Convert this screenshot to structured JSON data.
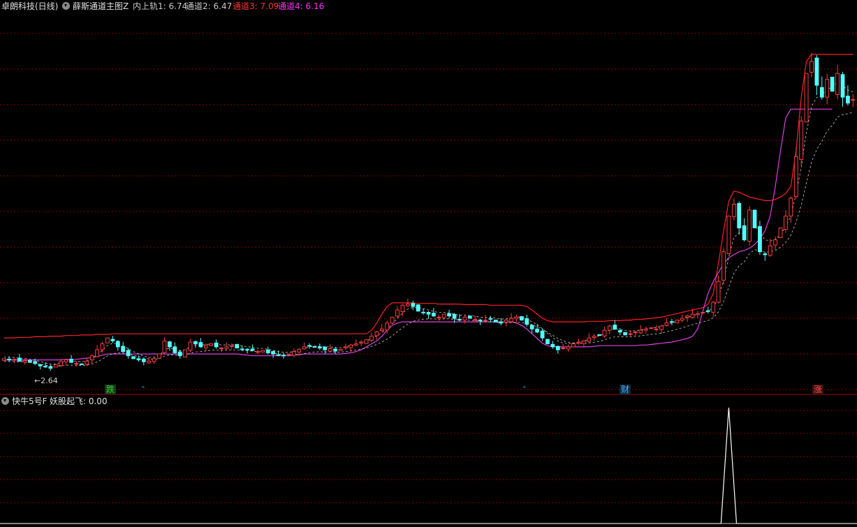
{
  "header": {
    "stock_name": "卓朗科技",
    "period": "(日线)",
    "indicator_name": "薛斯通道主图Z",
    "inner_upper_label": "内上轨1: 6.74",
    "channel2_label": "通道2: 6.47",
    "channel3_label": "通道3: 7.09",
    "channel4_label": "通道4: 6.16",
    "colors": {
      "white": "#c8c8c8",
      "channel3": "#ff3232",
      "channel4": "#ff32ff"
    }
  },
  "lower_panel": {
    "indicator_name": "快牛5号F",
    "value_label": "妖股起飞: 0.00"
  },
  "markers": [
    {
      "text": "跌",
      "color": "#30d030",
      "bg": "#1a3a1a"
    },
    {
      "text": "财",
      "color": "#40b0ff",
      "bg": "#102a40"
    },
    {
      "text": "涨",
      "color": "#ff5050",
      "bg": "#401010"
    }
  ],
  "low_price_label": "2.64",
  "chart_data": {
    "type": "candlestick",
    "price_range": [
      2.4,
      8.6
    ],
    "colors": {
      "up": "#ff3c3c",
      "down": "#54ffff",
      "upper_channel": "#ff2020",
      "lower_channel": "#e040e0",
      "dashed": "#c8c8c8",
      "grid": "#8b0000"
    },
    "closes": [
      2.8,
      2.78,
      2.79,
      2.76,
      2.77,
      2.74,
      2.72,
      2.68,
      2.66,
      2.64,
      2.7,
      2.75,
      2.78,
      2.74,
      2.72,
      2.7,
      2.76,
      2.85,
      2.95,
      3.05,
      3.15,
      3.1,
      3.0,
      2.92,
      2.85,
      2.8,
      2.78,
      2.75,
      2.76,
      2.8,
      2.88,
      3.1,
      3.0,
      2.9,
      2.85,
      2.95,
      3.08,
      3.05,
      3.0,
      3.02,
      3.05,
      3.0,
      2.98,
      3.0,
      3.02,
      2.98,
      2.96,
      2.95,
      2.94,
      2.92,
      2.94,
      2.9,
      2.88,
      2.86,
      2.85,
      2.88,
      2.92,
      2.96,
      3.0,
      3.02,
      3.0,
      2.98,
      2.95,
      2.97,
      2.93,
      2.96,
      3.0,
      3.03,
      3.05,
      3.08,
      3.12,
      3.18,
      3.25,
      3.3,
      3.4,
      3.5,
      3.62,
      3.7,
      3.72,
      3.68,
      3.6,
      3.58,
      3.55,
      3.52,
      3.5,
      3.55,
      3.52,
      3.48,
      3.45,
      3.5,
      3.48,
      3.46,
      3.44,
      3.45,
      3.47,
      3.42,
      3.4,
      3.45,
      3.48,
      3.5,
      3.45,
      3.38,
      3.3,
      3.25,
      3.15,
      3.05,
      3.0,
      2.95,
      2.98,
      3.0,
      3.05,
      3.08,
      3.1,
      3.15,
      3.18,
      3.2,
      3.28,
      3.35,
      3.3,
      3.25,
      3.2,
      3.22,
      3.25,
      3.28,
      3.3,
      3.32,
      3.3,
      3.35,
      3.4,
      3.42,
      3.45,
      3.48,
      3.52,
      3.55,
      3.56,
      3.58,
      3.6,
      3.75,
      4.1,
      4.6,
      5.2,
      5.4,
      5.0,
      4.8,
      5.3,
      5.0,
      4.6,
      4.55,
      4.7,
      4.8,
      5.0,
      5.2,
      5.5,
      6.2,
      6.8,
      7.6,
      7.8,
      7.4,
      7.2,
      7.5,
      7.3,
      7.6,
      7.2,
      7.1,
      7.16
    ],
    "upper_channel": [
      3.15,
      3.15,
      3.15,
      3.16,
      3.16,
      3.16,
      3.17,
      3.17,
      3.17,
      3.18,
      3.18,
      3.18,
      3.19,
      3.19,
      3.19,
      3.2,
      3.2,
      3.2,
      3.21,
      3.21,
      3.21,
      3.22,
      3.22,
      3.22,
      3.22,
      3.22,
      3.22,
      3.22,
      3.22,
      3.22,
      3.22,
      3.22,
      3.22,
      3.22,
      3.22,
      3.22,
      3.22,
      3.22,
      3.22,
      3.22,
      3.22,
      3.22,
      3.22,
      3.22,
      3.22,
      3.22,
      3.22,
      3.22,
      3.22,
      3.22,
      3.22,
      3.22,
      3.22,
      3.22,
      3.22,
      3.22,
      3.22,
      3.22,
      3.22,
      3.22,
      3.22,
      3.22,
      3.22,
      3.22,
      3.22,
      3.22,
      3.22,
      3.22,
      3.22,
      3.22,
      3.22,
      3.28,
      3.4,
      3.55,
      3.68,
      3.74,
      3.74,
      3.74,
      3.74,
      3.74,
      3.73,
      3.73,
      3.73,
      3.73,
      3.72,
      3.72,
      3.72,
      3.72,
      3.72,
      3.71,
      3.71,
      3.71,
      3.71,
      3.71,
      3.7,
      3.7,
      3.7,
      3.7,
      3.7,
      3.7,
      3.7,
      3.68,
      3.62,
      3.55,
      3.48,
      3.44,
      3.42,
      3.42,
      3.42,
      3.42,
      3.42,
      3.42,
      3.42,
      3.43,
      3.43,
      3.43,
      3.43,
      3.44,
      3.44,
      3.44,
      3.45,
      3.45,
      3.46,
      3.46,
      3.47,
      3.48,
      3.49,
      3.5,
      3.52,
      3.54,
      3.56,
      3.58,
      3.6,
      3.62,
      3.64,
      3.66,
      3.72,
      3.9,
      4.4,
      4.95,
      5.45,
      5.62,
      5.6,
      5.56,
      5.52,
      5.5,
      5.48,
      5.46,
      5.46,
      5.48,
      5.52,
      5.58,
      5.7,
      6.3,
      7.2,
      7.8,
      7.92,
      7.92,
      7.92,
      7.92,
      7.92,
      7.92,
      7.92,
      7.92,
      7.92
    ],
    "lower_channel": [
      2.78,
      2.78,
      2.78,
      2.78,
      2.78,
      2.78,
      2.78,
      2.78,
      2.78,
      2.78,
      2.78,
      2.78,
      2.79,
      2.79,
      2.79,
      2.8,
      2.81,
      2.82,
      2.84,
      2.86,
      2.88,
      2.88,
      2.88,
      2.88,
      2.88,
      2.88,
      2.88,
      2.88,
      2.88,
      2.88,
      2.88,
      2.88,
      2.88,
      2.88,
      2.88,
      2.88,
      2.88,
      2.88,
      2.88,
      2.88,
      2.88,
      2.88,
      2.88,
      2.88,
      2.88,
      2.88,
      2.87,
      2.86,
      2.85,
      2.85,
      2.85,
      2.85,
      2.85,
      2.85,
      2.85,
      2.85,
      2.86,
      2.87,
      2.88,
      2.88,
      2.88,
      2.88,
      2.88,
      2.88,
      2.88,
      2.88,
      2.89,
      2.9,
      2.92,
      2.95,
      3.0,
      3.05,
      3.1,
      3.18,
      3.28,
      3.36,
      3.4,
      3.42,
      3.42,
      3.42,
      3.42,
      3.42,
      3.42,
      3.42,
      3.42,
      3.42,
      3.42,
      3.42,
      3.42,
      3.42,
      3.42,
      3.42,
      3.42,
      3.42,
      3.42,
      3.42,
      3.42,
      3.42,
      3.42,
      3.4,
      3.36,
      3.3,
      3.22,
      3.14,
      3.06,
      3.02,
      3.0,
      3.0,
      3.0,
      3.0,
      3.0,
      3.0,
      3.0,
      3.0,
      3.01,
      3.02,
      3.02,
      3.02,
      3.02,
      3.02,
      3.02,
      3.02,
      3.02,
      3.03,
      3.03,
      3.04,
      3.05,
      3.06,
      3.07,
      3.08,
      3.1,
      3.12,
      3.14,
      3.18,
      3.3,
      3.6,
      3.9,
      4.1,
      4.25,
      4.4,
      4.5,
      4.55,
      4.6,
      4.62,
      4.66,
      4.72,
      4.82,
      4.95,
      5.2,
      5.7,
      6.3,
      6.85,
      7.0,
      7.0,
      7.0,
      7.0,
      7.0,
      7.0,
      7.0,
      7.0,
      7.0
    ],
    "lower_indicator": {
      "range": [
        0,
        1
      ],
      "spike_index": 140,
      "spike_value": 1
    }
  }
}
